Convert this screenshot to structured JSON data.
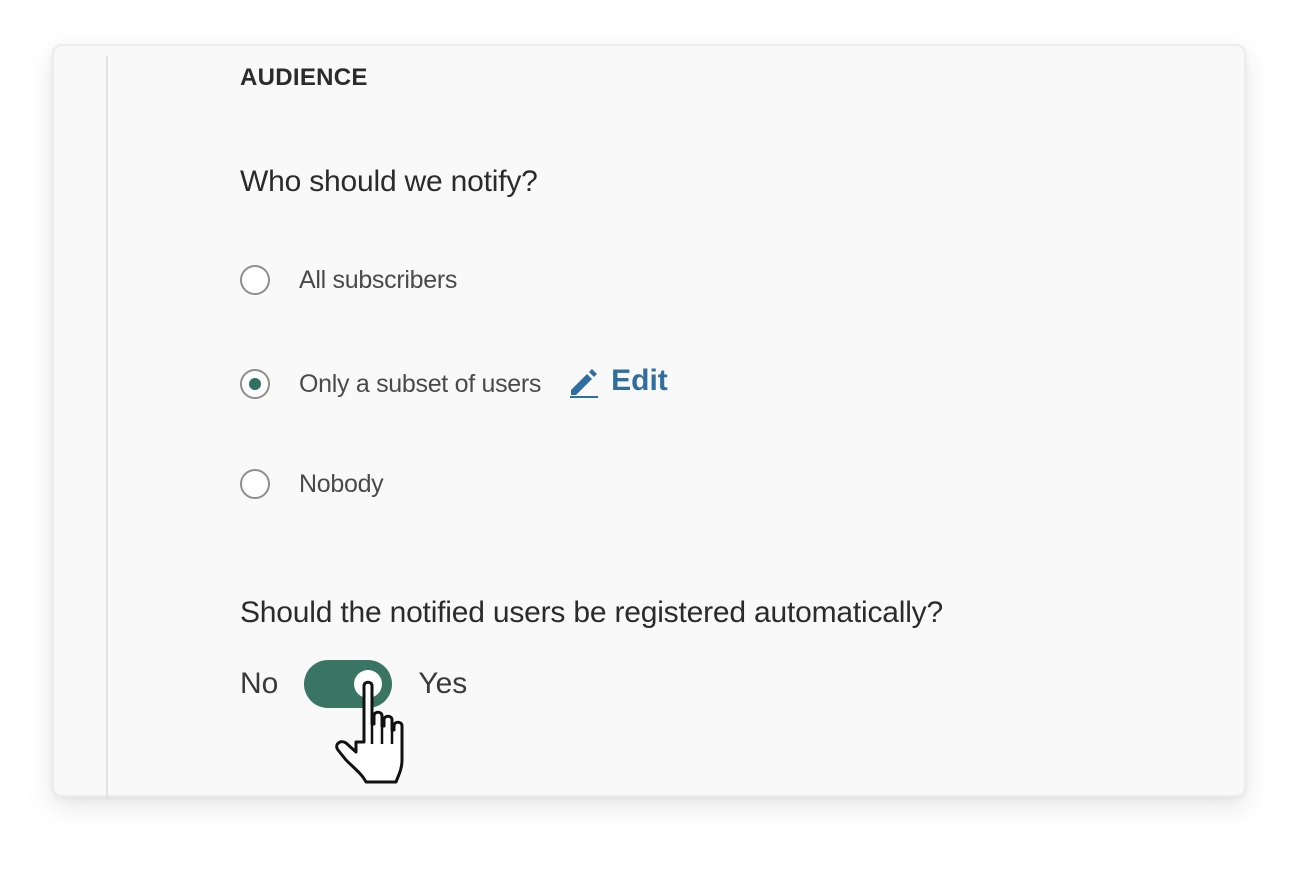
{
  "audience": {
    "section_title": "AUDIENCE",
    "notify_question": "Who should we notify?",
    "options": [
      {
        "label": "All subscribers",
        "checked": false
      },
      {
        "label": "Only a subset of users",
        "checked": true
      },
      {
        "label": "Nobody",
        "checked": false
      }
    ],
    "edit_link": {
      "label": "Edit",
      "icon": "pencil-icon"
    },
    "register_question": "Should the notified users be registered automatically?",
    "toggle": {
      "off_label": "No",
      "on_label": "Yes",
      "state": "on"
    }
  },
  "colors": {
    "accent_green": "#3a7564",
    "link_blue": "#2f6e9e"
  },
  "cursor": {
    "icon": "hand-pointer-icon"
  }
}
